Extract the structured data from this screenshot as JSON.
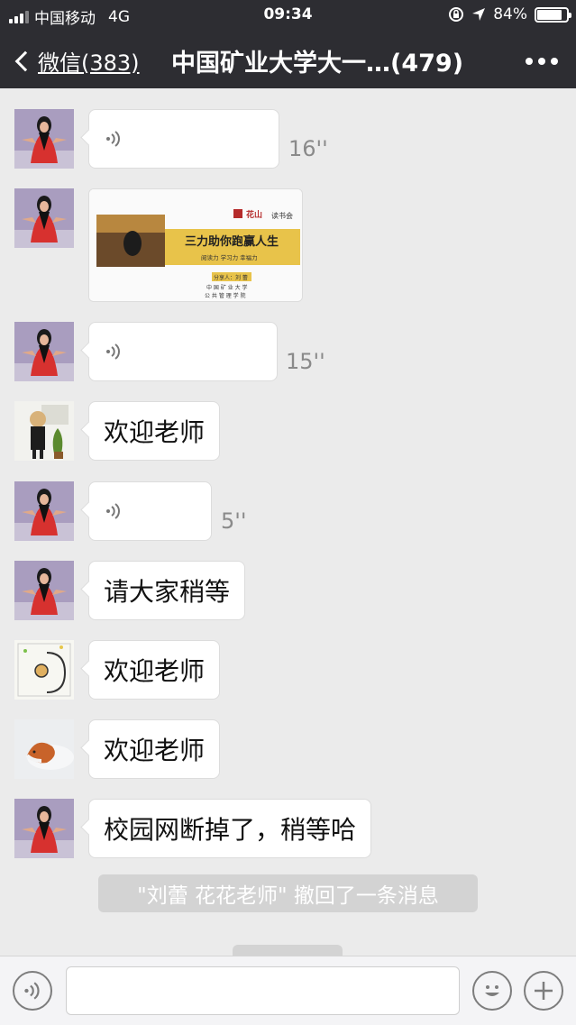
{
  "status_bar": {
    "carrier": "中国移动",
    "network": "4G",
    "time": "09:34",
    "battery_text": "84%",
    "battery_level": 0.84
  },
  "nav": {
    "back_label": "微信(383)",
    "title": "中国矿业大学大一…(479)"
  },
  "messages": [
    {
      "type": "voice",
      "duration": "16''"
    },
    {
      "type": "card",
      "brand": "读书会",
      "headline": "三力助你跑赢人生",
      "subline": "阅读力  学习力  幸福力",
      "sharer": "分享人：刘  蕾",
      "school_line1": "中 国 矿 业 大 学",
      "school_line2": "公 共 管 理 学 院"
    },
    {
      "type": "voice",
      "duration": "15''"
    },
    {
      "type": "text",
      "text": "欢迎老师"
    },
    {
      "type": "voice",
      "duration": "5''"
    },
    {
      "type": "text",
      "text": "请大家稍等"
    },
    {
      "type": "text",
      "text": "欢迎老师"
    },
    {
      "type": "text",
      "text": "欢迎老师"
    },
    {
      "type": "text",
      "text": "校园网断掉了，稍等哈"
    }
  ],
  "system_notice": "\"刘蕾  花花老师\" 撤回了一条消息",
  "input_bar": {
    "voice_icon": "voice-icon",
    "emoji_icon": "emoji-icon",
    "plus_icon": "plus-icon",
    "text_value": ""
  },
  "colors": {
    "nav_bg": "#2d2d32",
    "chat_bg": "#ebebeb",
    "bubble_bg": "#ffffff",
    "card_accent": "#e8c34a",
    "avatar_red": "#d7312f"
  }
}
